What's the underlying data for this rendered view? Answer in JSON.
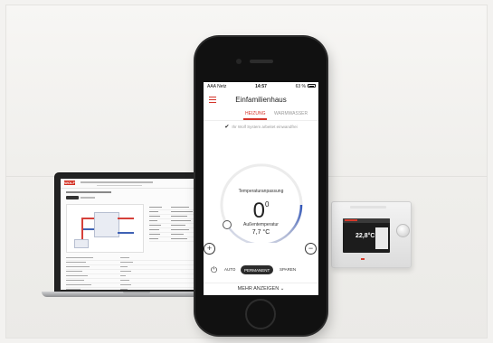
{
  "phone": {
    "carrier": "AAA Netz",
    "time": "14:57",
    "battery": "63 %",
    "app_title": "Einfamilienhaus",
    "tabs": [
      {
        "label": "HEIZUNG",
        "active": true
      },
      {
        "label": "WARMWASSER",
        "active": false
      }
    ],
    "system_status": "Ihr Wolf System arbeitet einwandfrei",
    "setpoint_label": "Temperaturanpassung",
    "setpoint_value": "0",
    "setpoint_unit": "0",
    "outside_label": "Außentemperatur",
    "outside_value": "7,7 °C",
    "plus_symbol": "+",
    "minus_symbol": "−",
    "modes": [
      {
        "label": "AUTO",
        "active": false
      },
      {
        "label": "PERMANENT",
        "active": true
      },
      {
        "label": "SPAREN",
        "active": false
      }
    ],
    "more_label": "MEHR ANZEIGEN",
    "icons": [
      "menu-icon",
      "check-icon",
      "power-icon",
      "chevron-down-icon"
    ]
  },
  "laptop": {
    "logo": "WOLF"
  },
  "device": {
    "temperature": "22,8°C"
  },
  "colors": {
    "accent": "#d4342a",
    "dial_gradient_start": "#d9dde8",
    "dial_gradient_end": "#2f54b8"
  }
}
